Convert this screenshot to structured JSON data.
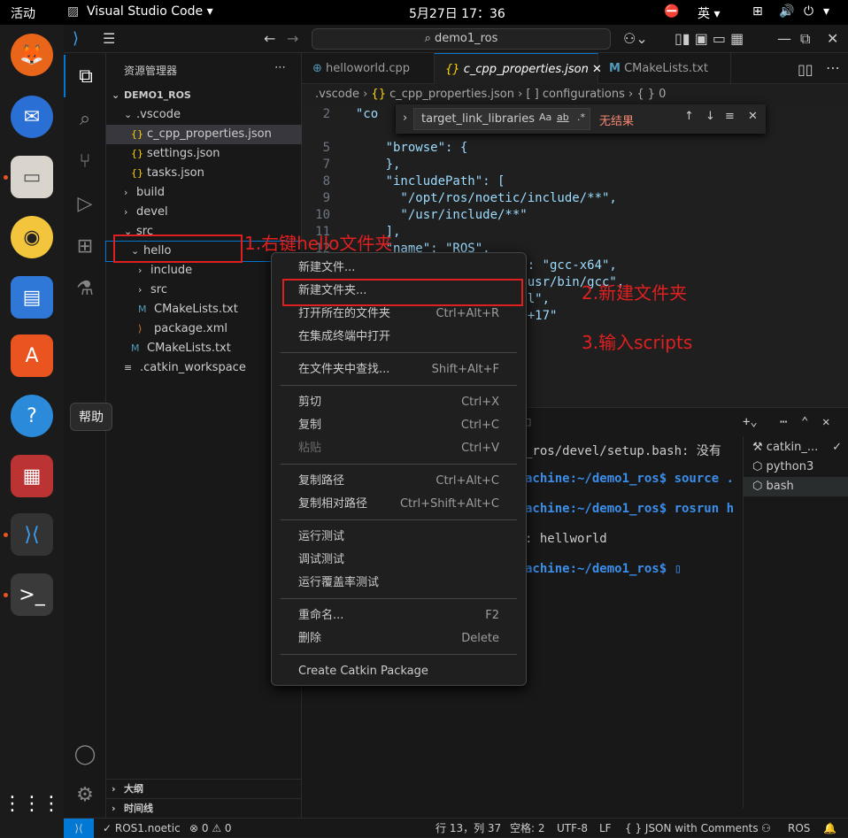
{
  "topbar": {
    "activities": "活动",
    "app": "Visual Studio Code ▾",
    "clock": "5月27日  17：36",
    "ime": "英 ▾"
  },
  "titlebar": {
    "search": "demo1_ros"
  },
  "explorer": {
    "title": "资源管理器",
    "root": "DEMO1_ROS",
    "items": [
      {
        "label": ".vscode",
        "chev": "⌄"
      },
      {
        "label": "c_cpp_properties.json",
        "icon": "{}"
      },
      {
        "label": "settings.json",
        "icon": "{}"
      },
      {
        "label": "tasks.json",
        "icon": "{}"
      },
      {
        "label": "build",
        "chev": "›"
      },
      {
        "label": "devel",
        "chev": "›"
      },
      {
        "label": "src",
        "chev": "⌄"
      },
      {
        "label": "hello",
        "chev": "⌄"
      },
      {
        "label": "include",
        "chev": "›"
      },
      {
        "label": "src",
        "chev": "›"
      },
      {
        "label": "CMakeLists.txt",
        "icon": "M"
      },
      {
        "label": "package.xml",
        "icon": "⟩"
      },
      {
        "label": "CMakeLists.txt",
        "icon": "M"
      },
      {
        "label": ".catkin_workspace",
        "icon": "≡"
      }
    ],
    "outline": "大纲",
    "timeline": "时间线"
  },
  "tabs": [
    "helloworld.cpp",
    "c_cpp_properties.json",
    "CMakeLists.txt"
  ],
  "breadcrumb": [
    ".vscode",
    "c_cpp_properties.json",
    "[ ] configurations",
    "{ } 0"
  ],
  "find": {
    "query": "target_link_libraries",
    "result": "无结果"
  },
  "code": [
    {
      "n": "2",
      "html": "  \"co"
    },
    {
      "n": "3",
      "html": ""
    },
    {
      "n": "4",
      "html": ""
    },
    {
      "n": "5",
      "html": "      \"browse\": {"
    },
    {
      "n": "7",
      "html": "      },"
    },
    {
      "n": "8",
      "html": "      \"includePath\": ["
    },
    {
      "n": "9",
      "html": "        \"/opt/ros/noetic/include/**\","
    },
    {
      "n": "10",
      "html": "        \"/usr/include/**\""
    },
    {
      "n": "11",
      "html": "      ],"
    },
    {
      "n": "12",
      "html": "      \"name\": \"ROS\","
    },
    {
      "n": "13",
      "html": "                       e\": \"gcc-x64\","
    },
    {
      "n": "14",
      "html": "                       \"/usr/bin/gcc\","
    },
    {
      "n": "15",
      "html": "                       ull\","
    },
    {
      "n": "16",
      "html": "                       c++17\""
    }
  ],
  "terminal": {
    "lines": [
      "_ros/devel/setup.bash: 没有",
      "achine:~/demo1_ros$ source .",
      "achine:~/demo1_ros$ rosrun h",
      ": hellworld",
      "achine:~/demo1_ros$ ▯"
    ],
    "list": [
      "catkin_...",
      "python3",
      "bash"
    ]
  },
  "menu": {
    "groups": [
      [
        {
          "label": "新建文件..."
        },
        {
          "label": "新建文件夹..."
        },
        {
          "label": "打开所在的文件夹",
          "kb": "Ctrl+Alt+R"
        },
        {
          "label": "在集成终端中打开"
        }
      ],
      [
        {
          "label": "在文件夹中查找...",
          "kb": "Shift+Alt+F"
        }
      ],
      [
        {
          "label": "剪切",
          "kb": "Ctrl+X"
        },
        {
          "label": "复制",
          "kb": "Ctrl+C"
        },
        {
          "label": "粘贴",
          "kb": "Ctrl+V",
          "disabled": true
        }
      ],
      [
        {
          "label": "复制路径",
          "kb": "Ctrl+Alt+C"
        },
        {
          "label": "复制相对路径",
          "kb": "Ctrl+Shift+Alt+C"
        }
      ],
      [
        {
          "label": "运行测试"
        },
        {
          "label": "调试测试"
        },
        {
          "label": "运行覆盖率测试"
        }
      ],
      [
        {
          "label": "重命名...",
          "kb": "F2"
        },
        {
          "label": "删除",
          "kb": "Delete"
        }
      ],
      [
        {
          "label": "Create Catkin Package"
        }
      ]
    ]
  },
  "tooltip": "帮助",
  "annotations": {
    "a1": "1.右键hello文件夹",
    "a2": "2.新建文件夹",
    "a3": "3.输入scripts"
  },
  "status": {
    "branch": "ROS1.noetic",
    "problems": "⊗ 0 ⚠ 0",
    "pos": "行 13，列 37",
    "spaces": "空格: 2",
    "enc": "UTF-8",
    "eol": "LF",
    "lang": "{ }  JSON with Comments",
    "ros": "ROS"
  }
}
